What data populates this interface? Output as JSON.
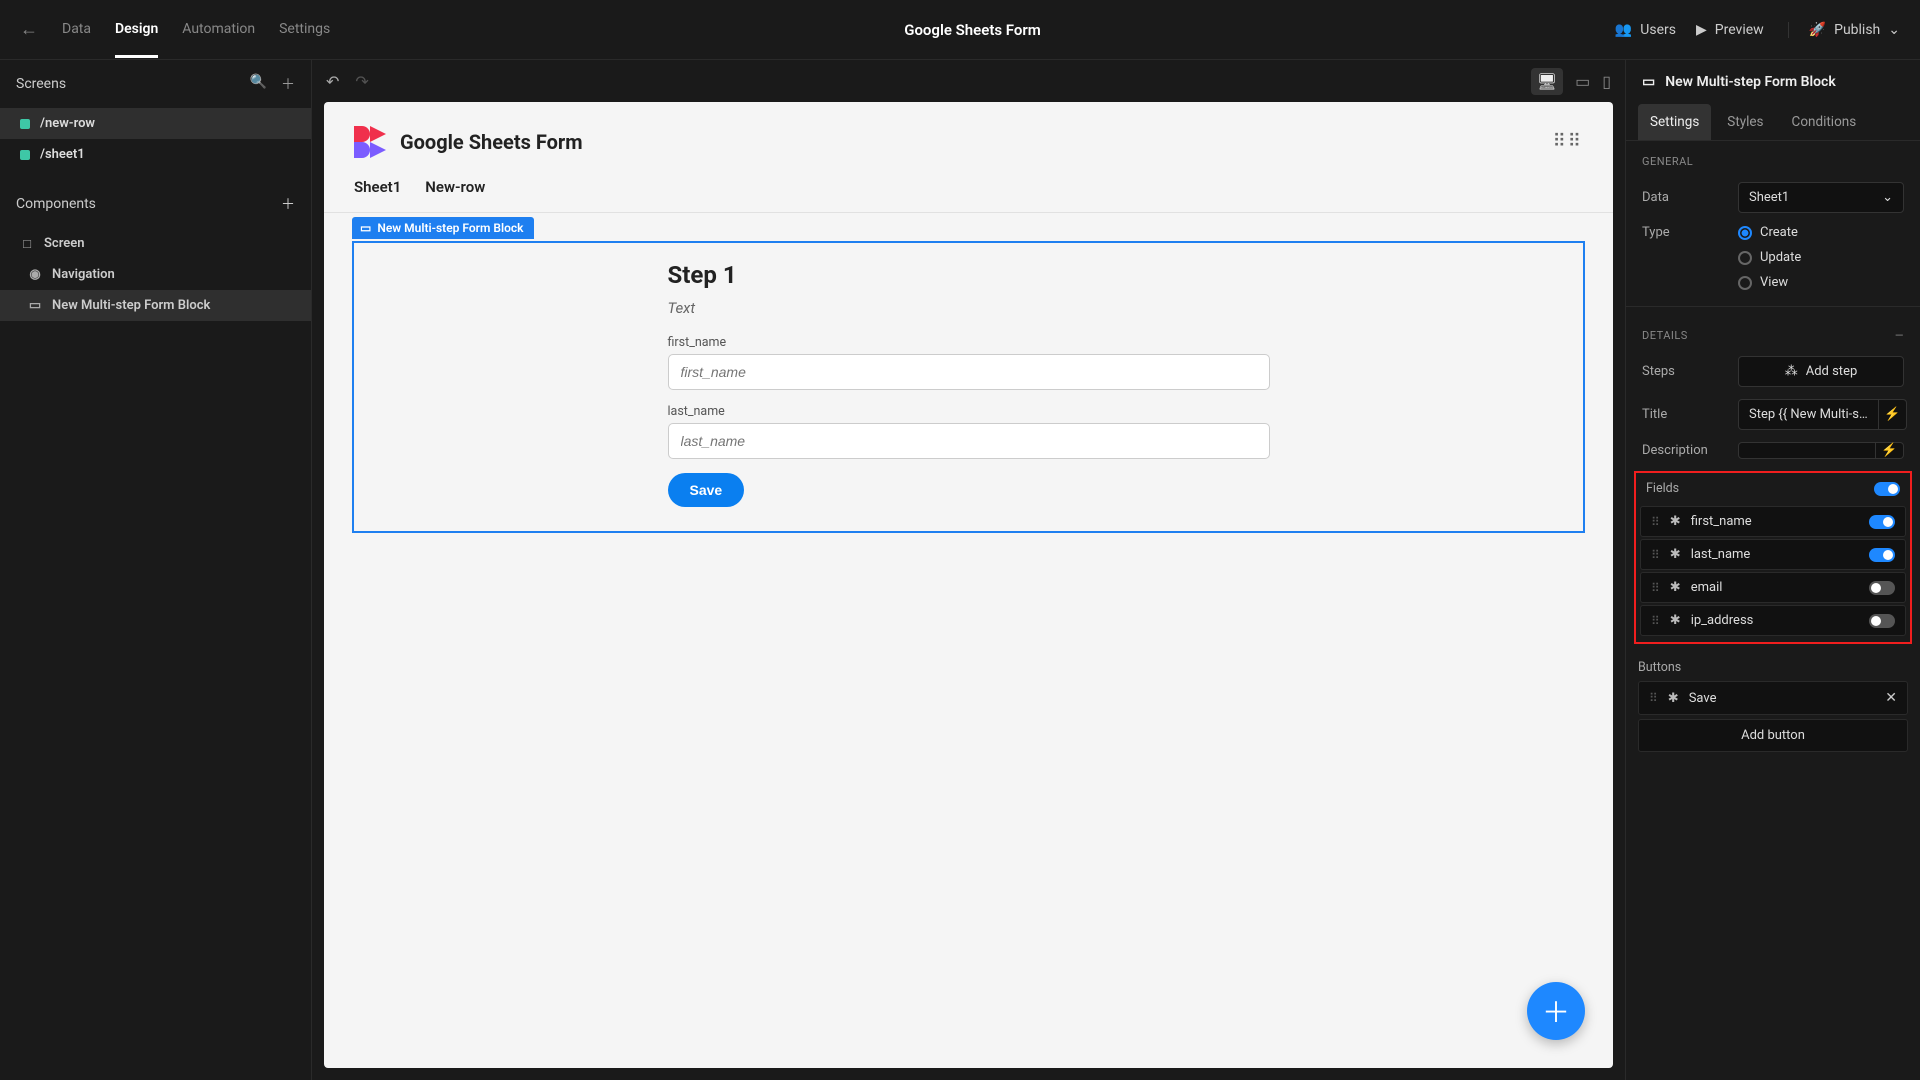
{
  "topbar": {
    "nav": [
      "Data",
      "Design",
      "Automation",
      "Settings"
    ],
    "active_nav": "Design",
    "title": "Google Sheets Form",
    "users": "Users",
    "preview": "Preview",
    "publish": "Publish"
  },
  "left": {
    "screens_label": "Screens",
    "screens": [
      "/new-row",
      "/sheet1"
    ],
    "active_screen": "/new-row",
    "components_label": "Components",
    "components": [
      {
        "label": "Screen",
        "icon": "□"
      },
      {
        "label": "Navigation",
        "icon": "◉"
      },
      {
        "label": "New Multi-step Form Block",
        "icon": "▭"
      }
    ],
    "active_component": "New Multi-step Form Block"
  },
  "canvas": {
    "brand_title": "Google Sheets Form",
    "tabs": [
      "Sheet1",
      "New-row"
    ],
    "selected_tag": "New Multi-step Form Block",
    "step_title": "Step 1",
    "step_desc": "Text",
    "fields": [
      {
        "label": "first_name",
        "placeholder": "first_name"
      },
      {
        "label": "last_name",
        "placeholder": "last_name"
      }
    ],
    "save": "Save"
  },
  "right": {
    "title": "New Multi-step Form Block",
    "tabs": [
      "Settings",
      "Styles",
      "Conditions"
    ],
    "active_tab": "Settings",
    "general_label": "GENERAL",
    "data_label": "Data",
    "data_value": "Sheet1",
    "type_label": "Type",
    "type_options": [
      "Create",
      "Update",
      "View"
    ],
    "type_selected": "Create",
    "details_label": "DETAILS",
    "steps_label": "Steps",
    "add_step": "Add step",
    "title_label": "Title",
    "title_value": "Step {{ New Multi-s…",
    "desc_label": "Description",
    "fields_label": "Fields",
    "fields": [
      {
        "name": "first_name",
        "on": true
      },
      {
        "name": "last_name",
        "on": true
      },
      {
        "name": "email",
        "on": false
      },
      {
        "name": "ip_address",
        "on": false
      }
    ],
    "buttons_label": "Buttons",
    "button_name": "Save",
    "add_button": "Add button"
  }
}
